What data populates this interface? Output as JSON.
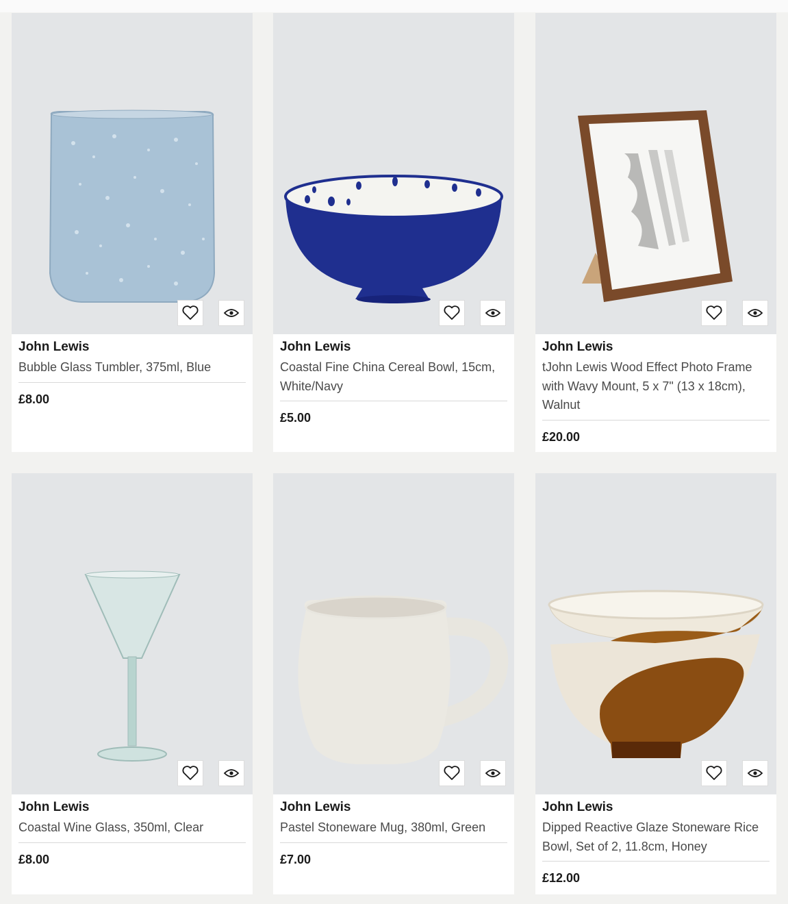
{
  "products": [
    {
      "brand": "John Lewis",
      "title": "Bubble Glass Tumbler, 375ml, Blue",
      "price": "£8.00",
      "image_icon": "tumbler-image"
    },
    {
      "brand": "John Lewis",
      "title": "Coastal Fine China Cereal Bowl, 15cm, White/Navy",
      "price": "£5.00",
      "image_icon": "bowl-image"
    },
    {
      "brand": "John Lewis",
      "title": "tJohn Lewis Wood Effect Photo Frame with Wavy Mount, 5 x 7\" (13 x 18cm), Walnut",
      "price": "£20.00",
      "image_icon": "photo-frame-image"
    },
    {
      "brand": "John Lewis",
      "title": "Coastal Wine Glass, 350ml, Clear",
      "price": "£8.00",
      "image_icon": "wine-glass-image"
    },
    {
      "brand": "John Lewis",
      "title": "Pastel Stoneware Mug, 380ml, Green",
      "price": "£7.00",
      "image_icon": "mug-image"
    },
    {
      "brand": "John Lewis",
      "title": "Dipped Reactive Glaze Stoneware Rice Bowl, Set of 2, 11.8cm, Honey",
      "price": "£12.00",
      "image_icon": "rice-bowls-image"
    }
  ],
  "actions": {
    "wishlist_icon": "heart-icon",
    "quickview_icon": "eye-icon"
  },
  "colors": {
    "background": "#f2f2f0",
    "card": "#ffffff",
    "image_bg": "#e3e5e7",
    "text": "#1f1f1f",
    "muted_text": "#4a4a4a",
    "navy": "#1f2f8f"
  }
}
